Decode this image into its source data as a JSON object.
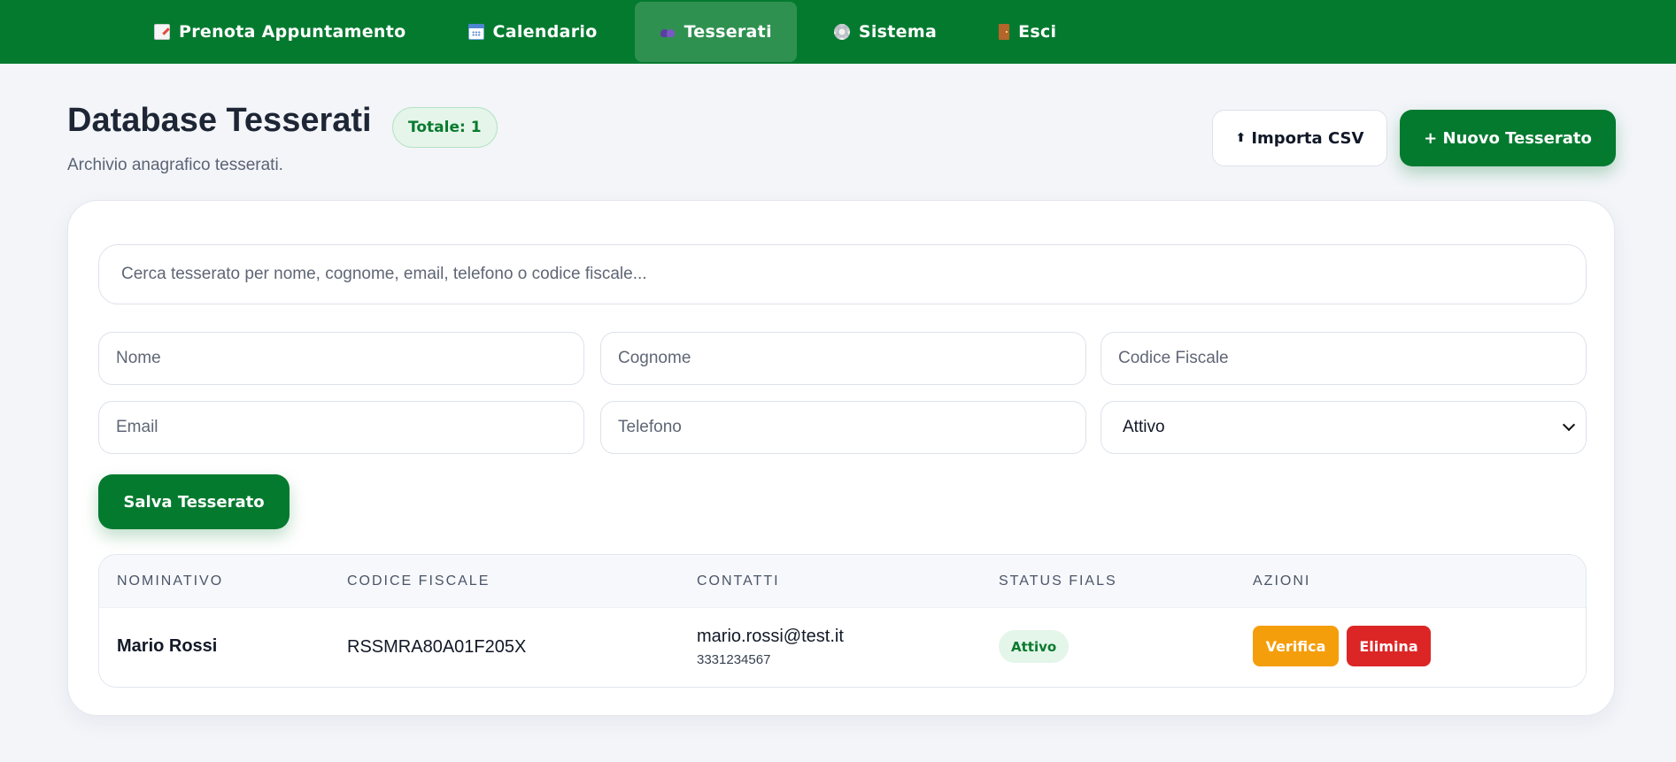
{
  "nav": {
    "items": [
      {
        "label": "Prenota Appuntamento",
        "icon": "memo-icon"
      },
      {
        "label": "Calendario",
        "icon": "calendar-icon"
      },
      {
        "label": "Tesserati",
        "icon": "users-icon"
      },
      {
        "label": "Sistema",
        "icon": "gear-icon"
      },
      {
        "label": "Esci",
        "icon": "door-icon"
      }
    ],
    "active": "Tesserati",
    "background": "#047a2f"
  },
  "header": {
    "title": "Database Tesserati",
    "total_badge": "Totale: 1",
    "subtitle": "Archivio anagrafico tesserati.",
    "import_label": "Importa CSV",
    "import_icon": "upload-arrow-icon",
    "new_label": "+ Nuovo Tesserato"
  },
  "search": {
    "placeholder": "Cerca tesserato per nome, cognome, email, telefono o codice fiscale..."
  },
  "form": {
    "nome_placeholder": "Nome",
    "cognome_placeholder": "Cognome",
    "codice_fiscale_placeholder": "Codice Fiscale",
    "email_placeholder": "Email",
    "telefono_placeholder": "Telefono",
    "status_selected": "Attivo",
    "save_label": "Salva Tesserato"
  },
  "table": {
    "headers": [
      "NOMINATIVO",
      "CODICE FISCALE",
      "CONTATTI",
      "STATUS FIALS",
      "AZIONI"
    ],
    "rows": [
      {
        "name": "Mario Rossi",
        "codice_fiscale": "RSSMRA80A01F205X",
        "email": "mario.rossi@test.it",
        "phone": "3331234567",
        "status": "Attivo",
        "verify_label": "Verifica",
        "delete_label": "Elimina"
      }
    ]
  },
  "colors": {
    "primary": "#047a2f",
    "warning": "#f59e0b",
    "danger": "#dc2626",
    "page_bg": "#f3f5f9"
  }
}
